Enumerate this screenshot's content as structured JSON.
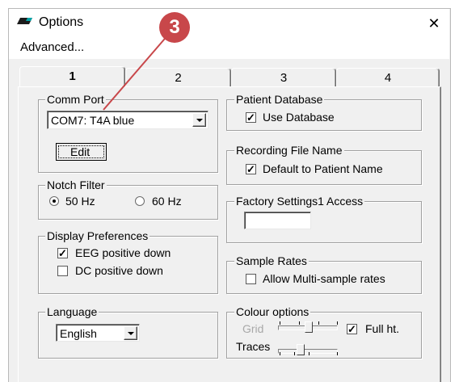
{
  "window": {
    "title": "Options",
    "close_glyph": "✕",
    "app_icon": "window-icon"
  },
  "menu": {
    "advanced": "Advanced..."
  },
  "callout": {
    "number": "3",
    "color": "#c8474a"
  },
  "tabs": [
    {
      "label": "1",
      "active": true
    },
    {
      "label": "2",
      "active": false
    },
    {
      "label": "3",
      "active": false
    },
    {
      "label": "4",
      "active": false
    }
  ],
  "comm_port": {
    "title": "Comm Port",
    "selected": "COM7: T4A blue",
    "edit_label": "Edit"
  },
  "notch_filter": {
    "title": "Notch Filter",
    "options": [
      "50 Hz",
      "60 Hz"
    ],
    "selected": "50 Hz"
  },
  "display_preferences": {
    "title": "Display Preferences",
    "items": [
      {
        "label": "EEG positive down",
        "checked": true
      },
      {
        "label": "DC positive down",
        "checked": false
      }
    ]
  },
  "language": {
    "title": "Language",
    "selected": "English"
  },
  "patient_database": {
    "title": "Patient Database",
    "use_database": {
      "label": "Use Database",
      "checked": true
    }
  },
  "recording_file_name": {
    "title": "Recording File Name",
    "default_to_patient": {
      "label": "Default to Patient Name",
      "checked": true
    }
  },
  "factory_settings": {
    "title": "Factory Settings1 Access",
    "value": ""
  },
  "sample_rates": {
    "title": "Sample Rates",
    "allow_multi": {
      "label": "Allow Multi-sample rates",
      "checked": false
    }
  },
  "colour_options": {
    "title": "Colour options",
    "grid_label": "Grid",
    "traces_label": "Traces",
    "full_ht": {
      "label": "Full ht.",
      "checked": true
    }
  }
}
